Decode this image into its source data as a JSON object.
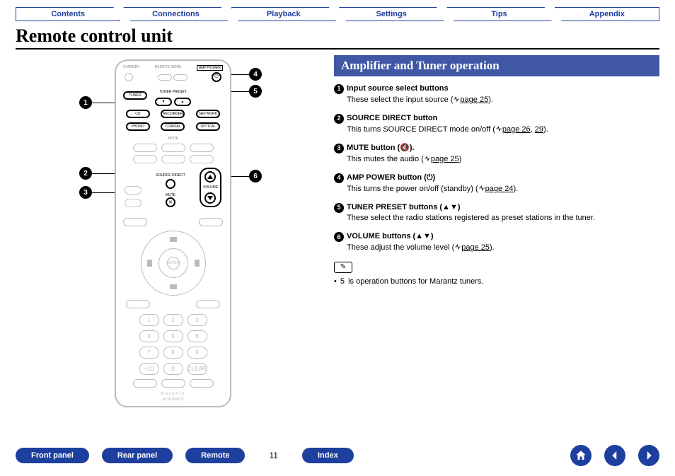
{
  "tabs": [
    "Contents",
    "Connections",
    "Playback",
    "Settings",
    "Tips",
    "Appendix"
  ],
  "page_title": "Remote control unit",
  "section_title": "Amplifier and Tuner operation",
  "items": [
    {
      "num": "1",
      "title": "Input source select buttons",
      "body_pre": "These select the input source (",
      "link": "page 25",
      "body_post": ")."
    },
    {
      "num": "2",
      "title": "SOURCE DIRECT button",
      "body_pre": "This turns SOURCE DIRECT mode on/off (",
      "link": "page 26",
      "link2": "29",
      "body_post": ")."
    },
    {
      "num": "3",
      "title": "MUTE button (🔇).",
      "body_pre": "This mutes the audio (",
      "link": "page 25",
      "body_post": ")"
    },
    {
      "num": "4",
      "title": "AMP POWER button (⏻)",
      "body_pre": "This turns the power on/off (standby) (",
      "link": "page 24",
      "body_post": ")."
    },
    {
      "num": "5",
      "title": "TUNER PRESET buttons (▲▼)",
      "body_plain": "These select the radio stations registered as preset stations in the tuner."
    },
    {
      "num": "6",
      "title": "VOLUME buttons (▲▼)",
      "body_pre": "These adjust the volume level (",
      "link": "page 25",
      "body_post": ")."
    }
  ],
  "note_bullet": "5",
  "note_text_pre": "• ",
  "note_text_post": " is operation buttons for Marantz tuners.",
  "bottom_buttons": [
    "Front panel",
    "Rear panel",
    "Remote"
  ],
  "index_button": "Index",
  "page_number": "11",
  "remote": {
    "amp_power": "AMP POWER",
    "remote_mode": "REMOTE MODE",
    "stdby": "STANDBY",
    "input_row1": [
      "TUNER",
      "",
      "",
      ""
    ],
    "tuner_preset": "TUNER PRESET",
    "input_row2": [
      "CD",
      "RECORDER",
      "NETWORK"
    ],
    "input_row3": [
      "PHONO",
      "COAXIAL",
      "OPTICAL"
    ],
    "mode": "MODE",
    "sd": "SOURCE DIRECT",
    "mute": "MUTE",
    "volume": "VOLUME",
    "enter": "ENTER",
    "nums": [
      "1",
      "2",
      "3",
      "4",
      "5",
      "6",
      "7",
      "8",
      "9",
      "+10",
      "0",
      "CLEAR"
    ],
    "brand": "marantz",
    "model": "RC001PMCD"
  }
}
